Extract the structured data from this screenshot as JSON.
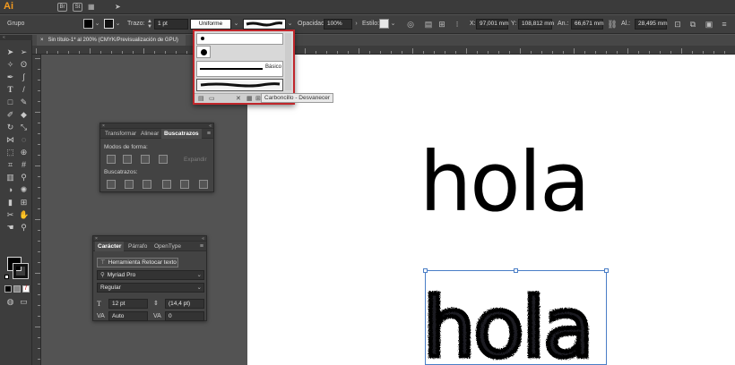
{
  "app": {
    "logo": "Ai",
    "bridge": "Br",
    "stock": "St"
  },
  "controlbar": {
    "selection_label": "Grupo",
    "stroke_label": "Trazo:",
    "stroke_weight": "1 pt",
    "stroke_profile": "Uniforme",
    "opacity_label": "Opacidad:",
    "opacity_value": "100%",
    "style_label": "Estilo:",
    "x_label": "X:",
    "x_value": "97,001 mm",
    "y_label": "Y:",
    "y_value": "108,812 mm",
    "width_label": "An.:",
    "width_value": "66,671 mm",
    "height_label": "Al.:",
    "height_value": "28,495 mm"
  },
  "document": {
    "tab_title": "Sin título-1* al 200% (CMYK/Previsualización de GPU)",
    "close_symbol": "×"
  },
  "brush_popup": {
    "section_label": "Básico",
    "tooltip": "Carboncillo - Desvanecer"
  },
  "transform_panel": {
    "tabs": [
      "Transformar",
      "Alinear",
      "Buscatrazos"
    ],
    "active_tab": 2,
    "shape_modes_label": "Modos de forma:",
    "expand_label": "Expandir",
    "pathfinders_label": "Buscatrazos:"
  },
  "character_panel": {
    "tabs": [
      "Carácter",
      "Párrafo",
      "OpenType"
    ],
    "active_tab": 0,
    "touch_type_label": "Herramienta Retocar texto",
    "font_family": "Myriad Pro",
    "font_style": "Regular",
    "font_size": "12 pt",
    "leading": "(14,4 pt)",
    "kerning": "Auto",
    "tracking": "0"
  },
  "artboard": {
    "text_top": "hola",
    "text_bottom": "hola"
  },
  "colors": {
    "brand": "#f29a1f",
    "highlight_border": "#c0262b",
    "selection": "#4a7ec6"
  }
}
